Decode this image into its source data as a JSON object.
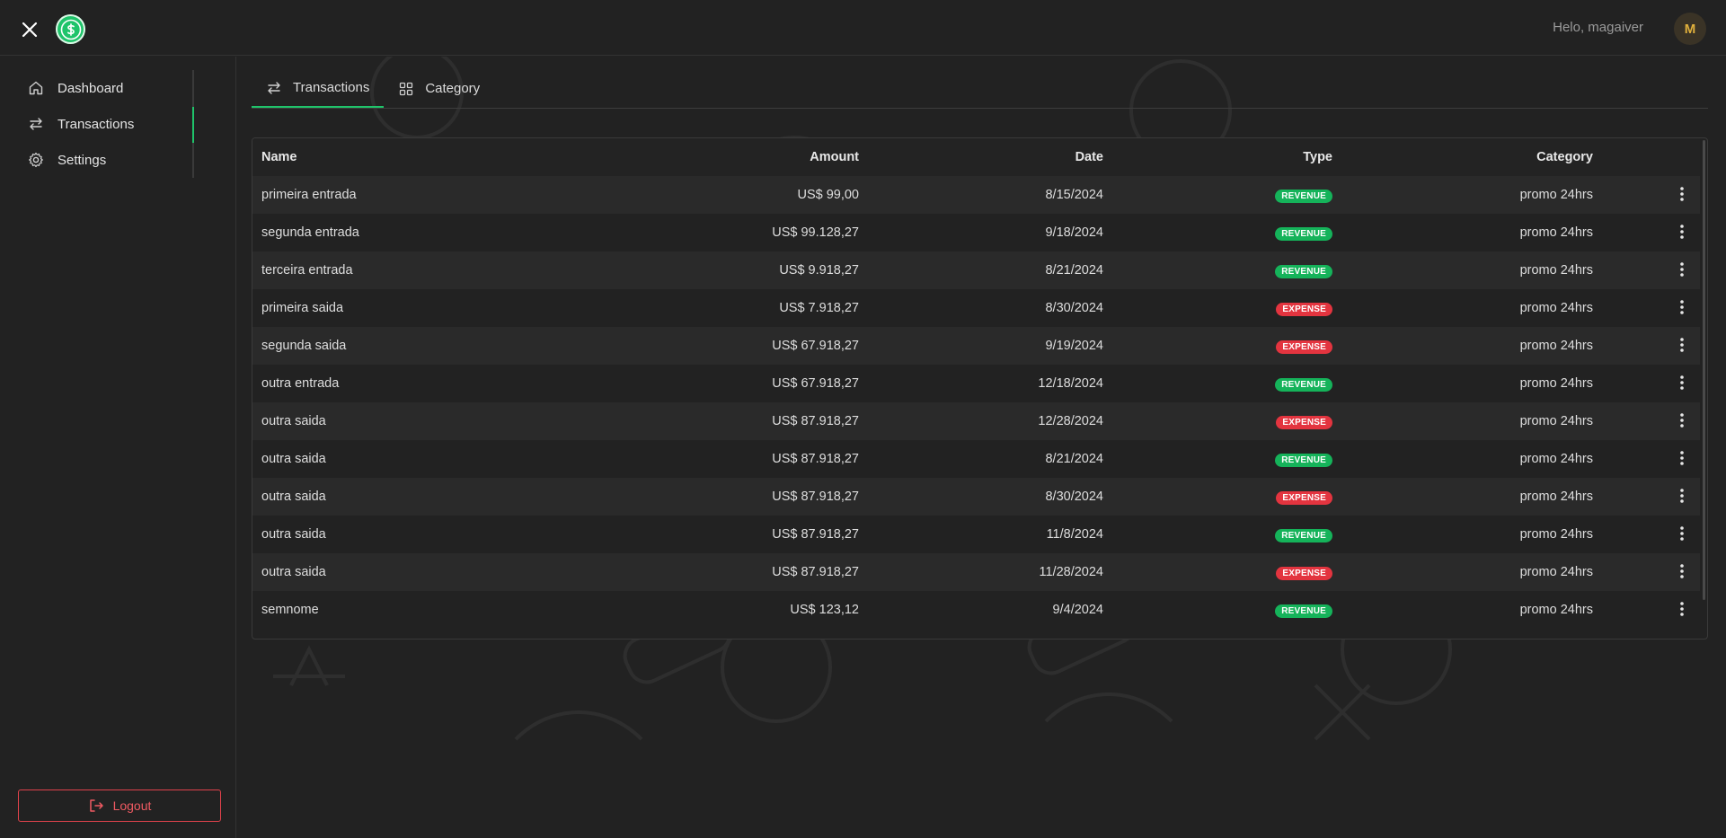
{
  "header": {
    "greeting": "Helo, magaiver",
    "avatar_initial": "M"
  },
  "sidebar": {
    "items": [
      {
        "label": "Dashboard",
        "icon": "home-icon"
      },
      {
        "label": "Transactions",
        "icon": "swap-arrows-icon",
        "active": true
      },
      {
        "label": "Settings",
        "icon": "gear-icon"
      }
    ],
    "logout_label": "Logout"
  },
  "tabs": [
    {
      "label": "Transactions",
      "icon": "swap-arrows-icon",
      "active": true
    },
    {
      "label": "Category",
      "icon": "grid-icon",
      "active": false
    }
  ],
  "table": {
    "columns": [
      "Name",
      "Amount",
      "Date",
      "Type",
      "Category"
    ],
    "rows": [
      {
        "name": "primeira entrada",
        "amount": "US$ 99,00",
        "date": "8/15/2024",
        "type": "REVENUE",
        "category": "promo 24hrs"
      },
      {
        "name": "segunda entrada",
        "amount": "US$ 99.128,27",
        "date": "9/18/2024",
        "type": "REVENUE",
        "category": "promo 24hrs"
      },
      {
        "name": "terceira entrada",
        "amount": "US$ 9.918,27",
        "date": "8/21/2024",
        "type": "REVENUE",
        "category": "promo 24hrs"
      },
      {
        "name": "primeira saida",
        "amount": "US$ 7.918,27",
        "date": "8/30/2024",
        "type": "EXPENSE",
        "category": "promo 24hrs"
      },
      {
        "name": "segunda saida",
        "amount": "US$ 67.918,27",
        "date": "9/19/2024",
        "type": "EXPENSE",
        "category": "promo 24hrs"
      },
      {
        "name": "outra entrada",
        "amount": "US$ 67.918,27",
        "date": "12/18/2024",
        "type": "REVENUE",
        "category": "promo 24hrs"
      },
      {
        "name": "outra saida",
        "amount": "US$ 87.918,27",
        "date": "12/28/2024",
        "type": "EXPENSE",
        "category": "promo 24hrs"
      },
      {
        "name": "outra saida",
        "amount": "US$ 87.918,27",
        "date": "8/21/2024",
        "type": "REVENUE",
        "category": "promo 24hrs"
      },
      {
        "name": "outra saida",
        "amount": "US$ 87.918,27",
        "date": "8/30/2024",
        "type": "EXPENSE",
        "category": "promo 24hrs"
      },
      {
        "name": "outra saida",
        "amount": "US$ 87.918,27",
        "date": "11/8/2024",
        "type": "REVENUE",
        "category": "promo 24hrs"
      },
      {
        "name": "outra saida",
        "amount": "US$ 87.918,27",
        "date": "11/28/2024",
        "type": "EXPENSE",
        "category": "promo 24hrs"
      },
      {
        "name": "semnome",
        "amount": "US$ 123,12",
        "date": "9/4/2024",
        "type": "REVENUE",
        "category": "promo 24hrs"
      }
    ]
  },
  "colors": {
    "accent": "#1fc46a",
    "revenue": "#15b35a",
    "expense": "#e3343f",
    "background": "#222222"
  }
}
